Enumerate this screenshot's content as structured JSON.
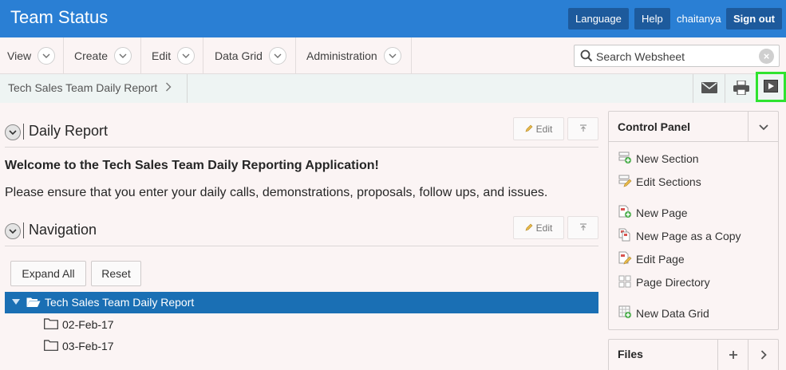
{
  "header": {
    "title": "Team Status",
    "language_label": "Language",
    "help_label": "Help",
    "username": "chaitanya",
    "signout_label": "Sign out"
  },
  "menu": {
    "items": [
      {
        "label": "View"
      },
      {
        "label": "Create"
      },
      {
        "label": "Edit"
      },
      {
        "label": "Data Grid"
      },
      {
        "label": "Administration"
      }
    ]
  },
  "search": {
    "placeholder": "Search Websheet"
  },
  "breadcrumb": {
    "current": "Tech Sales Team Daily Report"
  },
  "toolbar": {
    "icons": [
      "mail-icon",
      "print-icon",
      "presentation-play-icon"
    ],
    "highlight_color": "#2fe32f"
  },
  "daily_report": {
    "title": "Daily Report",
    "edit_label": "Edit",
    "welcome": "Welcome to the Tech Sales Team Daily Reporting Application!",
    "instructions": "Please ensure that you enter your daily calls, demonstrations, proposals, follow ups, and issues."
  },
  "navigation": {
    "title": "Navigation",
    "edit_label": "Edit",
    "expand_all_label": "Expand All",
    "reset_label": "Reset",
    "tree": {
      "root": "Tech Sales Team Daily Report",
      "children": [
        "02-Feb-17",
        "03-Feb-17"
      ]
    }
  },
  "control_panel": {
    "title": "Control Panel",
    "links": [
      {
        "label": "New Section"
      },
      {
        "label": "Edit Sections"
      },
      {
        "label": "New Page"
      },
      {
        "label": "New Page as a Copy"
      },
      {
        "label": "Edit Page"
      },
      {
        "label": "Page Directory"
      },
      {
        "label": "New Data Grid"
      }
    ]
  },
  "files": {
    "title": "Files"
  },
  "colors": {
    "header_blue": "#2a7fd4",
    "header_button": "#1d5a9c",
    "tree_selected": "#1a6fb4",
    "background": "#fbf4f4"
  }
}
